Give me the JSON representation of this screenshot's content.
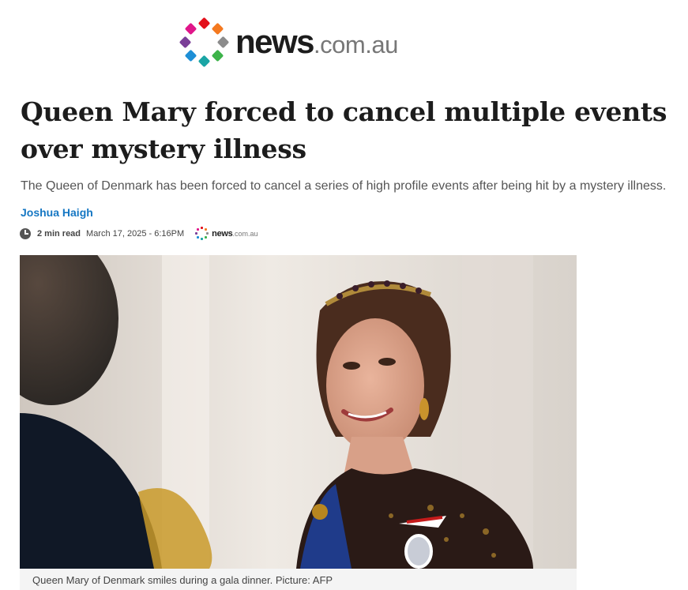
{
  "brand": {
    "name": "news",
    "domain": ".com.au",
    "dot_colors": [
      "#e3101b",
      "#f47920",
      "#8c8c8c",
      "#3db34a",
      "#1aa5a5",
      "#1e8fd6",
      "#7b3f98",
      "#e0168a"
    ]
  },
  "article": {
    "headline": "Queen Mary forced to cancel multiple events over mystery illness",
    "standfirst": "The Queen of Denmark has been forced to cancel a series of high profile events after being hit by a mystery illness.",
    "author": "Joshua Haigh",
    "read_time": "2 min read",
    "published": "March 17, 2025 - 6:16PM",
    "source_logo": {
      "name": "news",
      "domain": ".com.au"
    },
    "image_caption": "Queen Mary of Denmark smiles during a gala dinner. Picture: AFP"
  },
  "colors": {
    "byline": "#1577c3",
    "headline": "#1c1c1c",
    "standfirst": "#555555"
  },
  "icons": {
    "time": "clock-icon"
  }
}
